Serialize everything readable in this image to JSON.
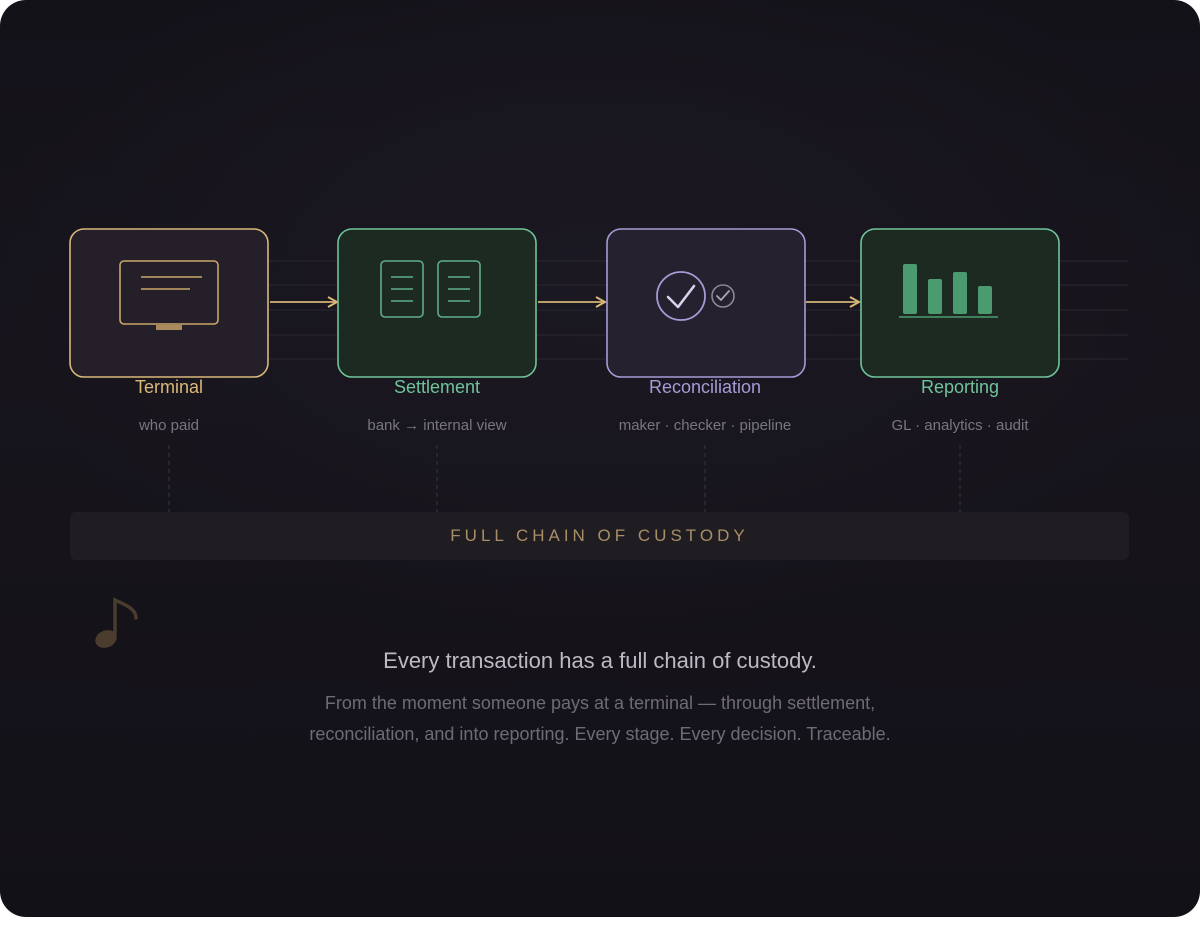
{
  "stages": [
    {
      "label": "Terminal",
      "sub": "who paid",
      "icon": "terminal-icon",
      "color": "#d9b878"
    },
    {
      "label": "Settlement",
      "sub": "bank → internal view",
      "icon": "documents-icon",
      "color": "#6fc49a"
    },
    {
      "label": "Reconciliation",
      "sub": "maker · checker · pipeline",
      "icon": "checkmark-icon",
      "color": "#a99ad6"
    },
    {
      "label": "Reporting",
      "sub": "GL · analytics · audit",
      "icon": "bar-chart-icon",
      "color": "#6fc49a"
    }
  ],
  "custody_bar": {
    "label": "FULL CHAIN OF CUSTODY"
  },
  "headline": "Every transaction has a full chain of custody.",
  "body": "From the moment someone pays at a terminal — through settlement, reconciliation, and into reporting. Every stage. Every decision. Traceable.",
  "colors": {
    "arrow": "#d9b878",
    "accent_gold": "#d9b878",
    "accent_green": "#6fc49a",
    "accent_purple": "#a99ad6",
    "background": "#141219"
  },
  "icons": [
    "terminal-icon",
    "documents-icon",
    "checkmark-icon",
    "bar-chart-icon",
    "music-note-icon"
  ]
}
